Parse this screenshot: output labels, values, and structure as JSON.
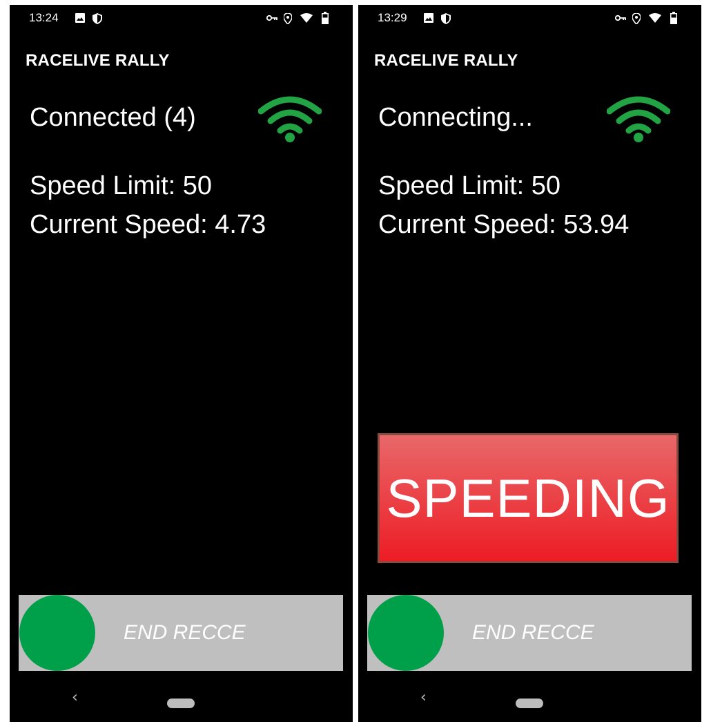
{
  "screens": [
    {
      "status_time": "13:24",
      "app_title": "RACELIVE RALLY",
      "connection_status": "Connected (4)",
      "speed_limit": "Speed Limit: 50",
      "current_speed": "Current Speed: 4.73",
      "slider_label": "END RECCE"
    },
    {
      "status_time": "13:29",
      "app_title": "RACELIVE RALLY",
      "connection_status": "Connecting...",
      "speed_limit": "Speed Limit: 50",
      "current_speed": "Current Speed: 53.94",
      "alert_label": "SPEEDING",
      "slider_label": "END RECCE"
    }
  ],
  "colors": {
    "background": "#000000",
    "wifi_green": "#22a344",
    "knob_green": "#00a04a",
    "slider_track": "#bfbfbf",
    "alert_red": "#ed1c24"
  },
  "icons": {
    "status_bar_left": [
      "image-icon",
      "shield-icon"
    ],
    "status_bar_right": [
      "vpn-key-icon",
      "location-icon",
      "wifi-icon",
      "battery-icon"
    ],
    "connection": "wifi-signal-icon",
    "nav": [
      "back-icon",
      "home-pill-icon"
    ]
  }
}
